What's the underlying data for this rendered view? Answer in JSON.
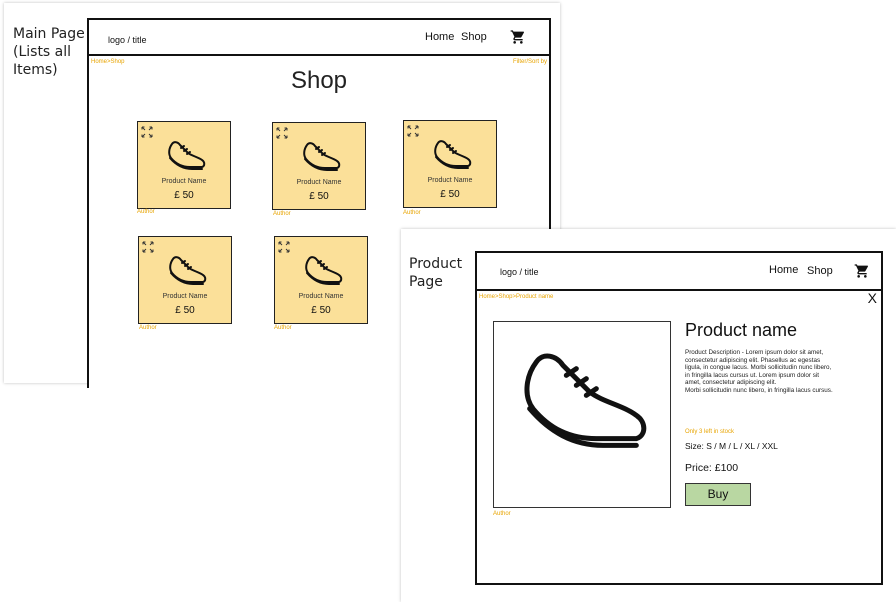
{
  "main": {
    "label": "Main Page\n(Lists all\nItems)",
    "logo": "logo / title",
    "nav": {
      "home": "Home",
      "shop": "Shop"
    },
    "breadcrumb": "Home>Shop",
    "filter": "Filter/Sort by",
    "title": "Shop",
    "cards": [
      {
        "name": "Product Name",
        "price": "£ 50",
        "author": "Author"
      },
      {
        "name": "Product Name",
        "price": "£ 50",
        "author": "Author"
      },
      {
        "name": "Product Name",
        "price": "£ 50",
        "author": "Author"
      },
      {
        "name": "Product Name",
        "price": "£ 50",
        "author": "Author"
      },
      {
        "name": "Product Name",
        "price": "£ 50",
        "author": "Author"
      }
    ]
  },
  "product": {
    "label": "Product\nPage",
    "logo": "logo / title",
    "nav": {
      "home": "Home",
      "shop": "Shop"
    },
    "breadcrumb": "Home>Shop>Product name",
    "close": "X",
    "name": "Product name",
    "description": "Product Description - Lorem ipsum dolor sit amet,\nconsectetur adipiscing elit. Phasellus ac egestas\nligula, in congue lacus. Morbi sollicitudin nunc libero,\nin fringilla lacus cursus ut. Lorem ipsum dolor sit\namet, consectetur adipiscing elit.\nMorbi sollicitudin nunc libero, in fringilla lacus cursus.",
    "stock": "Only 3 left in stock",
    "size": "Size: S / M / L / XL / XXL",
    "price": "Price: £100",
    "buy": "Buy",
    "author": "Author"
  },
  "colors": {
    "card": "#fbe099",
    "accent": "#e8a400",
    "buy": "#b9d7a2"
  }
}
